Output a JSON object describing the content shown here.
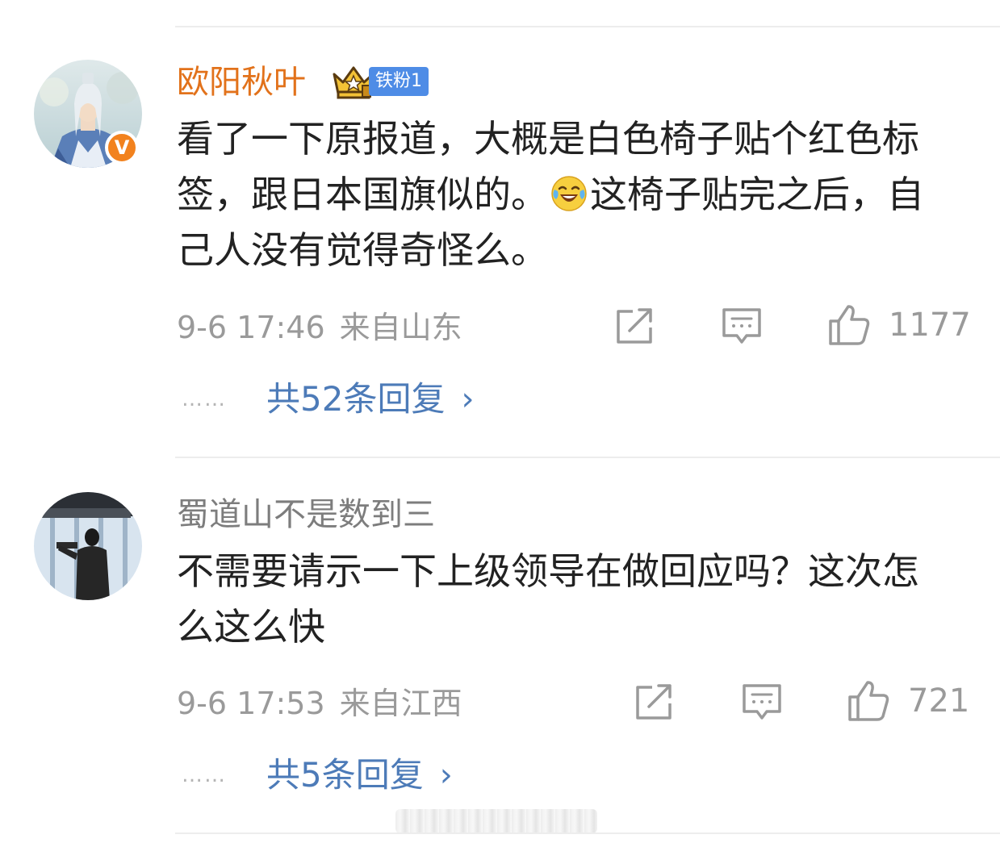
{
  "comments": [
    {
      "username": "欧阳秋叶",
      "fan_badge": "铁粉1",
      "text_before_emoji": "看了一下原报道，大概是白色椅子贴个红色标签，跟日本国旗似的。",
      "emoji": "laugh-cry-emoji",
      "text_after_emoji": "这椅子贴完之后，自己人没有觉得奇怪么。",
      "time": "9-6 17:46",
      "location": "来自山东",
      "likes": "1177",
      "reply_dots": "……",
      "replies_label": "共52条回复",
      "verified_badge": "V",
      "name_color": "#e2721b"
    },
    {
      "username": "蜀道山不是数到三",
      "text": "不需要请示一下上级领导在做回应吗？这次怎么这么快",
      "time": "9-6 17:53",
      "location": "来自江西",
      "likes": "721",
      "reply_dots": "……",
      "replies_label": "共5条回复",
      "name_color": "#7d7d7d"
    }
  ],
  "chevron": "›",
  "colors": {
    "link": "#4d7bb8",
    "meta": "#9a9a9a",
    "verified": "#f2821e",
    "fan_badge": "#4e8ce6",
    "divider": "#ededed"
  }
}
